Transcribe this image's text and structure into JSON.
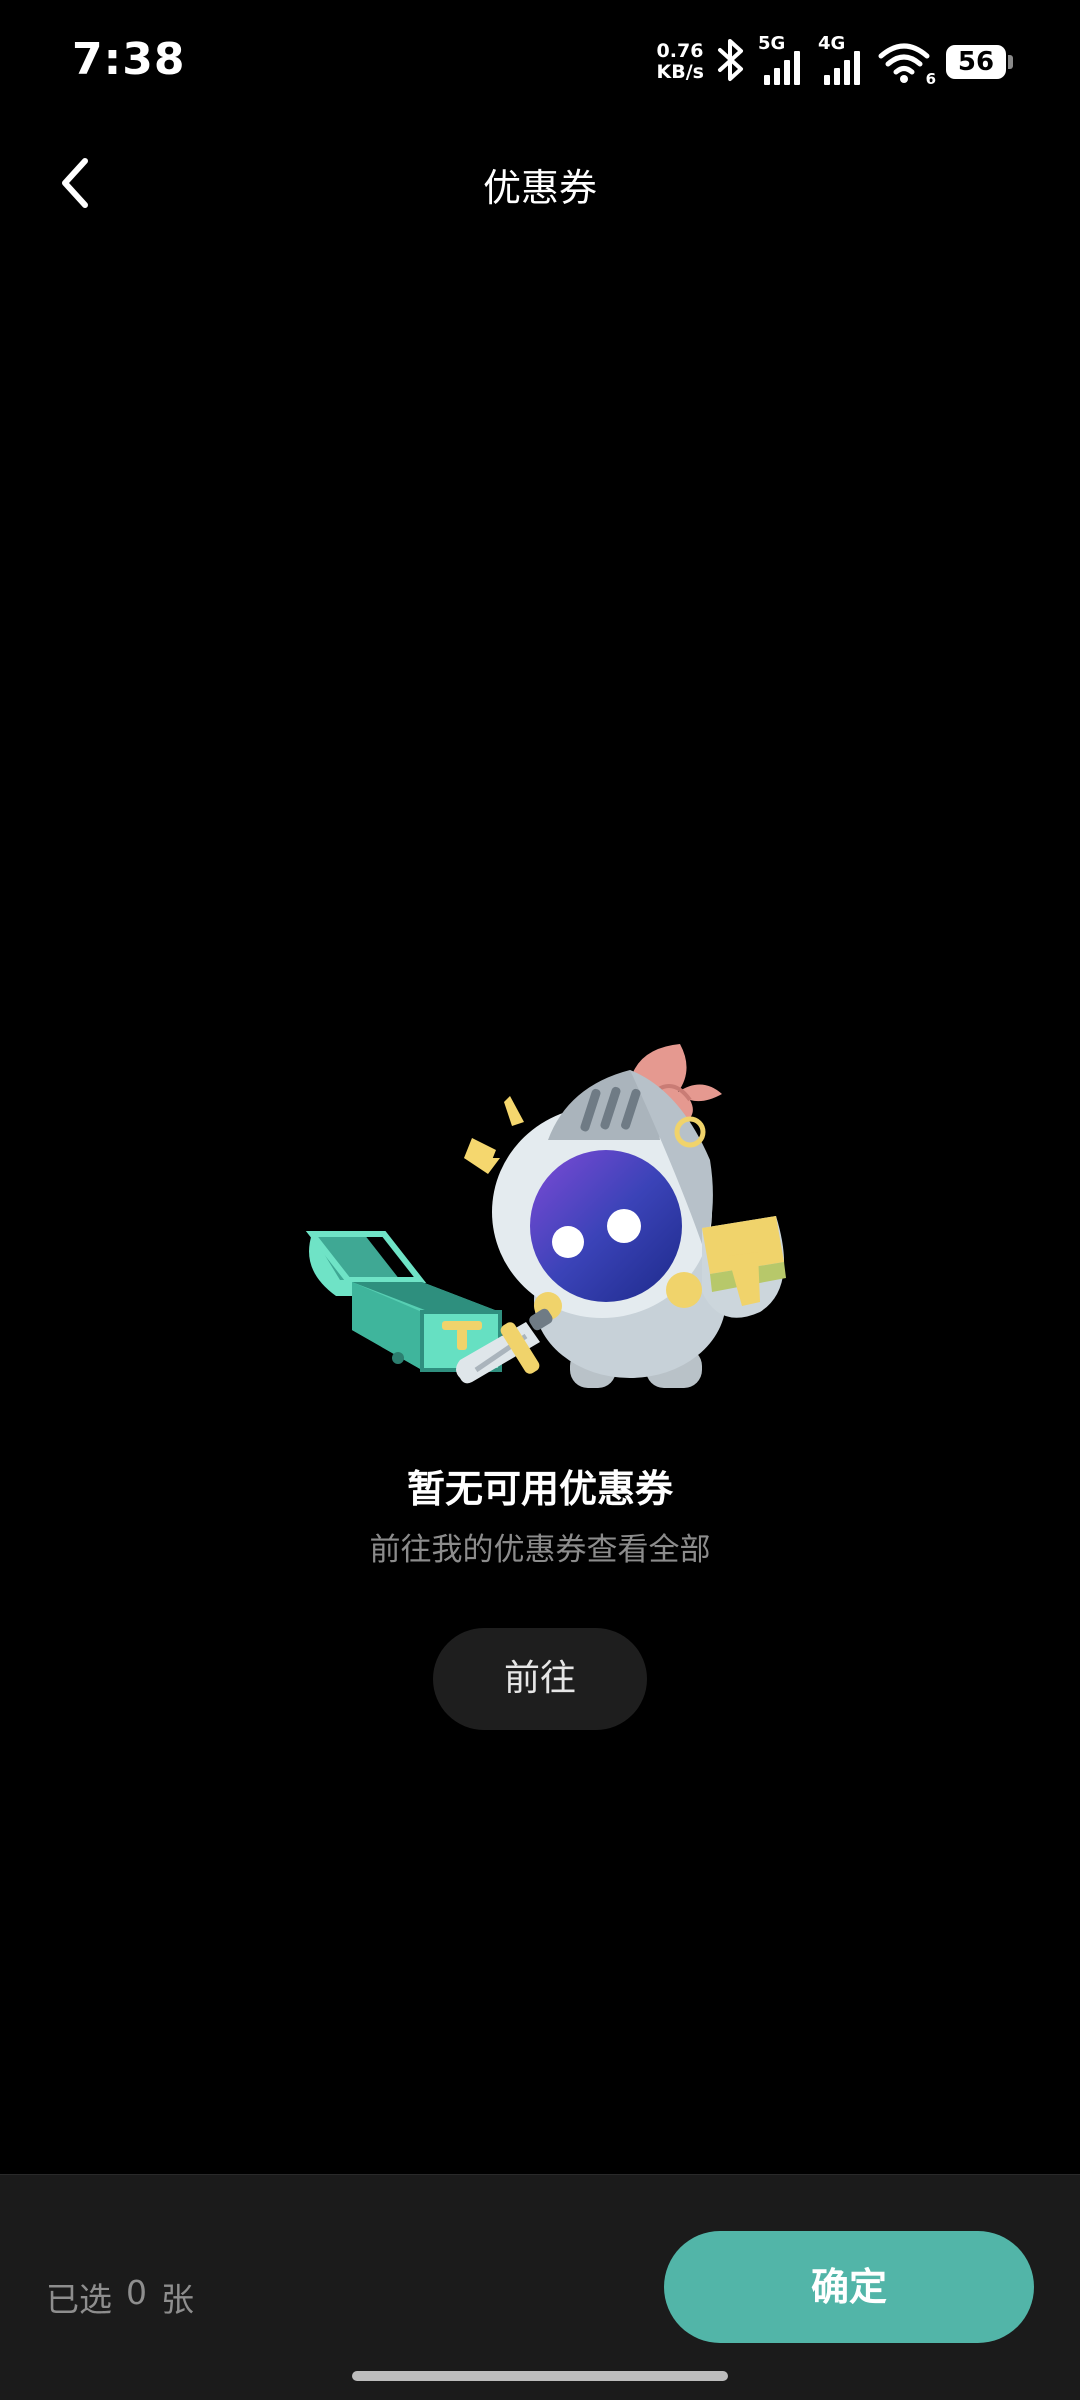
{
  "status_bar": {
    "time": "7:38",
    "net_speed_value": "0.76",
    "net_speed_unit": "KB/s",
    "signal_1_label": "5G",
    "signal_2_label": "4G",
    "wifi_label": "6",
    "battery_level": "56",
    "icons": [
      "bluetooth-icon",
      "signal-5g-icon",
      "signal-4g-icon",
      "wifi-icon",
      "battery-icon"
    ]
  },
  "header": {
    "title": "优惠券",
    "back_icon": "chevron-left-icon"
  },
  "empty_state": {
    "title": "暂无可用优惠券",
    "subtitle": "前往我的优惠券查看全部",
    "button_label": "前往"
  },
  "footer": {
    "selected_prefix": "已选",
    "selected_count": "0",
    "selected_suffix": "张",
    "confirm_label": "确定"
  },
  "colors": {
    "background": "#000000",
    "accent": "#52b5a8",
    "secondary_button": "#1e1e1e",
    "bottom_bar": "#1b1b1b",
    "muted_text": "#8c8c8c"
  }
}
